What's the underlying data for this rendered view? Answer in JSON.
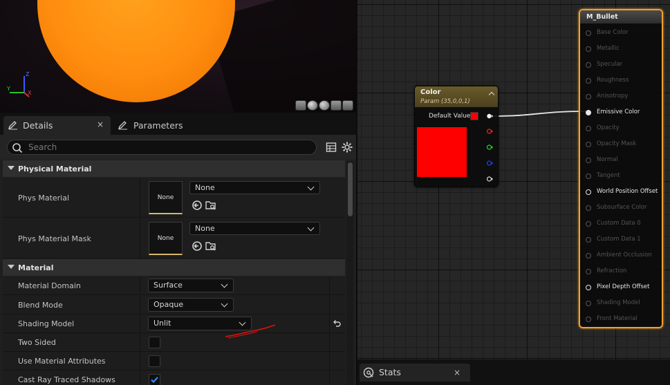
{
  "viewport": {
    "axis_labels": {
      "x": "X",
      "y": "Y",
      "z": "Z"
    },
    "preview_shapes": [
      "cylinder-icon",
      "sphere-icon",
      "plane-icon",
      "cube-icon",
      "mesh-icon"
    ]
  },
  "tabs": {
    "details": "Details",
    "parameters": "Parameters",
    "close": "×"
  },
  "toolbar": {
    "search_placeholder": "Search"
  },
  "sections": {
    "physical_material": "Physical Material",
    "material": "Material"
  },
  "properties": {
    "phys_material": {
      "label": "Phys Material",
      "thumb": "None",
      "value": "None"
    },
    "phys_material_mask": {
      "label": "Phys Material Mask",
      "thumb": "None",
      "value": "None"
    },
    "material_domain": {
      "label": "Material Domain",
      "value": "Surface"
    },
    "blend_mode": {
      "label": "Blend Mode",
      "value": "Opaque"
    },
    "shading_model": {
      "label": "Shading Model",
      "value": "Unlit"
    },
    "two_sided": {
      "label": "Two Sided",
      "checked": false
    },
    "use_material_attributes": {
      "label": "Use Material Attributes",
      "checked": false
    },
    "cast_ray_traced_shadows": {
      "label": "Cast Ray Traced Shadows",
      "checked": true
    }
  },
  "graph": {
    "color_node": {
      "title": "Color",
      "subtitle": "Param (35,0,0,1)",
      "default_value_label": "Default Value",
      "color": "#ff0000",
      "pins": [
        "white",
        "red",
        "green",
        "blue",
        "alpha"
      ]
    },
    "material_node": {
      "title": "M_Bullet",
      "inputs": [
        {
          "label": "Base Color",
          "active": false,
          "connected": false
        },
        {
          "label": "Metallic",
          "active": false,
          "connected": false
        },
        {
          "label": "Specular",
          "active": false,
          "connected": false
        },
        {
          "label": "Roughness",
          "active": false,
          "connected": false
        },
        {
          "label": "Anisotropy",
          "active": false,
          "connected": false
        },
        {
          "label": "Emissive Color",
          "active": true,
          "connected": true
        },
        {
          "label": "Opacity",
          "active": false,
          "connected": false
        },
        {
          "label": "Opacity Mask",
          "active": false,
          "connected": false
        },
        {
          "label": "Normal",
          "active": false,
          "connected": false
        },
        {
          "label": "Tangent",
          "active": false,
          "connected": false
        },
        {
          "label": "World Position Offset",
          "active": true,
          "connected": false
        },
        {
          "label": "Subsurface Color",
          "active": false,
          "connected": false
        },
        {
          "label": "Custom Data 0",
          "active": false,
          "connected": false
        },
        {
          "label": "Custom Data 1",
          "active": false,
          "connected": false
        },
        {
          "label": "Ambient Occlusion",
          "active": false,
          "connected": false
        },
        {
          "label": "Refraction",
          "active": false,
          "connected": false
        },
        {
          "label": "Pixel Depth Offset",
          "active": true,
          "connected": false
        },
        {
          "label": "Shading Model",
          "active": false,
          "connected": false
        },
        {
          "label": "Front Material",
          "active": false,
          "connected": false
        }
      ]
    }
  },
  "stats_tab": {
    "label": "Stats",
    "close": "×"
  },
  "colors": {
    "accent_selected_node": "#f0a030",
    "param_header": "#6a5b29",
    "sphere": "#ff8d0e",
    "annotation": "#ff0000"
  }
}
